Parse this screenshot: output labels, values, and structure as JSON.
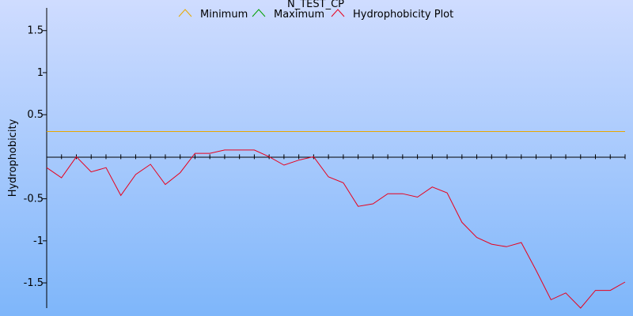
{
  "chart_data": {
    "type": "line",
    "title": "N_TEST_CP",
    "xlabel": "",
    "ylabel": "Hydrophobicity",
    "ylim": [
      -1.8,
      1.77
    ],
    "xlim": [
      1,
      40
    ],
    "grid": false,
    "legend": "top-center",
    "y_ticks": [
      1.5,
      1,
      0.5,
      -0.5,
      -1,
      -1.5
    ],
    "y_tick_labels": [
      "1.5",
      "1",
      "0.5",
      "-0.5",
      "-1",
      "-1.5"
    ],
    "x_minor_ticks": 40,
    "series": [
      {
        "name": "Minimum",
        "color": "#e8a800",
        "x": [
          1,
          40
        ],
        "y": [
          0.3,
          0.3
        ]
      },
      {
        "name": "Maximum",
        "color": "#00a000",
        "x": [],
        "y": []
      },
      {
        "name": "Hydrophobicity Plot",
        "color": "#e8001c",
        "x": [
          1,
          2,
          3,
          4,
          5,
          6,
          7,
          8,
          9,
          10,
          11,
          12,
          13,
          14,
          15,
          16,
          17,
          18,
          19,
          20,
          21,
          22,
          23,
          24,
          25,
          26,
          27,
          28,
          29,
          30,
          31,
          32,
          33,
          34,
          35,
          36,
          37,
          38,
          39,
          40
        ],
        "y": [
          -0.13,
          -0.25,
          0,
          -0.18,
          -0.13,
          -0.46,
          -0.21,
          -0.09,
          -0.33,
          -0.19,
          0.04,
          0.04,
          0.08,
          0.08,
          0.08,
          0,
          -0.1,
          -0.04,
          0,
          -0.24,
          -0.31,
          -0.59,
          -0.56,
          -0.44,
          -0.44,
          -0.48,
          -0.36,
          -0.43,
          -0.78,
          -0.96,
          -1.04,
          -1.07,
          -1.02,
          -1.35,
          -1.7,
          -1.62,
          -1.8,
          -1.59,
          -1.59,
          -1.49
        ]
      }
    ]
  }
}
